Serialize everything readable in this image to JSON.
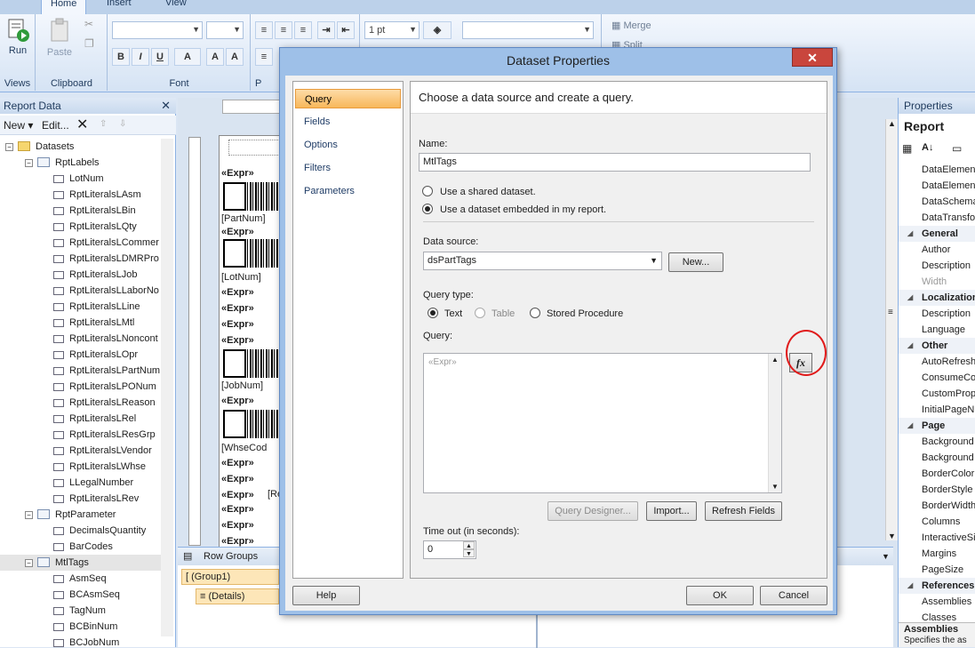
{
  "ribbon": {
    "tabs": [
      "Home",
      "Insert",
      "View"
    ],
    "run_label": "Run",
    "paste_label": "Paste",
    "groups": [
      "Views",
      "Clipboard",
      "Font",
      "P"
    ],
    "border_width": "1 pt",
    "merge_label": "Merge",
    "split_label": "Split"
  },
  "report_data": {
    "title": "Report Data",
    "new_label": "New",
    "edit_label": "Edit...",
    "tree": [
      {
        "label": "Datasets",
        "level": 0,
        "kind": "folder"
      },
      {
        "label": "RptLabels",
        "level": 1,
        "kind": "dataset"
      },
      {
        "label": "LotNum",
        "level": 2,
        "kind": "field"
      },
      {
        "label": "RptLiteralsLAsm",
        "level": 2,
        "kind": "field"
      },
      {
        "label": "RptLiteralsLBin",
        "level": 2,
        "kind": "field"
      },
      {
        "label": "RptLiteralsLQty",
        "level": 2,
        "kind": "field"
      },
      {
        "label": "RptLiteralsLCommer",
        "level": 2,
        "kind": "field"
      },
      {
        "label": "RptLiteralsLDMRPro",
        "level": 2,
        "kind": "field"
      },
      {
        "label": "RptLiteralsLJob",
        "level": 2,
        "kind": "field"
      },
      {
        "label": "RptLiteralsLLaborNo",
        "level": 2,
        "kind": "field"
      },
      {
        "label": "RptLiteralsLLine",
        "level": 2,
        "kind": "field"
      },
      {
        "label": "RptLiteralsLMtl",
        "level": 2,
        "kind": "field"
      },
      {
        "label": "RptLiteralsLNoncont",
        "level": 2,
        "kind": "field"
      },
      {
        "label": "RptLiteralsLOpr",
        "level": 2,
        "kind": "field"
      },
      {
        "label": "RptLiteralsLPartNum",
        "level": 2,
        "kind": "field"
      },
      {
        "label": "RptLiteralsLPONum",
        "level": 2,
        "kind": "field"
      },
      {
        "label": "RptLiteralsLReason",
        "level": 2,
        "kind": "field"
      },
      {
        "label": "RptLiteralsLRel",
        "level": 2,
        "kind": "field"
      },
      {
        "label": "RptLiteralsLResGrp",
        "level": 2,
        "kind": "field"
      },
      {
        "label": "RptLiteralsLVendor",
        "level": 2,
        "kind": "field"
      },
      {
        "label": "RptLiteralsLWhse",
        "level": 2,
        "kind": "field"
      },
      {
        "label": "LLegalNumber",
        "level": 2,
        "kind": "field"
      },
      {
        "label": "RptLiteralsLRev",
        "level": 2,
        "kind": "field"
      },
      {
        "label": "RptParameter",
        "level": 1,
        "kind": "dataset"
      },
      {
        "label": "DecimalsQuantity",
        "level": 2,
        "kind": "field"
      },
      {
        "label": "BarCodes",
        "level": 2,
        "kind": "field"
      },
      {
        "label": "MtlTags",
        "level": 1,
        "kind": "dataset"
      },
      {
        "label": "AsmSeq",
        "level": 2,
        "kind": "field"
      },
      {
        "label": "BCAsmSeq",
        "level": 2,
        "kind": "field"
      },
      {
        "label": "TagNum",
        "level": 2,
        "kind": "field"
      },
      {
        "label": "BCBinNum",
        "level": 2,
        "kind": "field"
      },
      {
        "label": "BCJobNum",
        "level": 2,
        "kind": "field"
      }
    ]
  },
  "design": {
    "expr": "«Expr»",
    "fields": [
      "[PartNum]",
      "[LotNum]",
      "[JobNum]",
      "[WhseCod",
      "[Re"
    ]
  },
  "row_groups": {
    "title": "Row Groups",
    "items": [
      "(Group1)",
      "(Details)"
    ]
  },
  "properties": {
    "title": "Properties",
    "object": "Report",
    "rows": [
      {
        "name": "DataElemen",
        "cat": false
      },
      {
        "name": "DataElemen",
        "cat": false
      },
      {
        "name": "DataSchema",
        "cat": false
      },
      {
        "name": "DataTransfo",
        "cat": false
      },
      {
        "name": "General",
        "cat": true
      },
      {
        "name": "Author",
        "cat": false
      },
      {
        "name": "Description",
        "cat": false
      },
      {
        "name": "Width",
        "cat": false
      },
      {
        "name": "Localization",
        "cat": true
      },
      {
        "name": "Description",
        "cat": false
      },
      {
        "name": "Language",
        "cat": false
      },
      {
        "name": "Other",
        "cat": true
      },
      {
        "name": "AutoRefresh",
        "cat": false
      },
      {
        "name": "ConsumeCo",
        "cat": false
      },
      {
        "name": "CustomProp",
        "cat": false
      },
      {
        "name": "InitialPageN",
        "cat": false
      },
      {
        "name": "Page",
        "cat": true
      },
      {
        "name": "Background",
        "cat": false
      },
      {
        "name": "Background",
        "cat": false
      },
      {
        "name": "BorderColor",
        "cat": false
      },
      {
        "name": "BorderStyle",
        "cat": false
      },
      {
        "name": "BorderWidth",
        "cat": false
      },
      {
        "name": "Columns",
        "cat": false
      },
      {
        "name": "InteractiveSi",
        "cat": false
      },
      {
        "name": "Margins",
        "cat": false
      },
      {
        "name": "PageSize",
        "cat": false
      },
      {
        "name": "References",
        "cat": true
      },
      {
        "name": "Assemblies",
        "cat": false
      },
      {
        "name": "Classes",
        "cat": false
      }
    ],
    "footer_title": "Assemblies",
    "footer_desc": "Specifies the as"
  },
  "dialog": {
    "title": "Dataset Properties",
    "nav": [
      "Query",
      "Fields",
      "Options",
      "Filters",
      "Parameters"
    ],
    "header": "Choose a data source and create a query.",
    "name_label": "Name:",
    "name_value": "MtlTags",
    "shared_label": "Use a shared dataset.",
    "embedded_label": "Use a dataset embedded in my report.",
    "datasource_label": "Data source:",
    "datasource_value": "dsPartTags",
    "new_button": "New...",
    "querytype_label": "Query type:",
    "qt_text": "Text",
    "qt_table": "Table",
    "qt_sp": "Stored Procedure",
    "query_label": "Query:",
    "query_value": "«Expr»",
    "fx_label": "fx",
    "query_designer": "Query Designer...",
    "import": "Import...",
    "refresh": "Refresh Fields",
    "timeout_label": "Time out (in seconds):",
    "timeout_value": "0",
    "help": "Help",
    "ok": "OK",
    "cancel": "Cancel"
  }
}
